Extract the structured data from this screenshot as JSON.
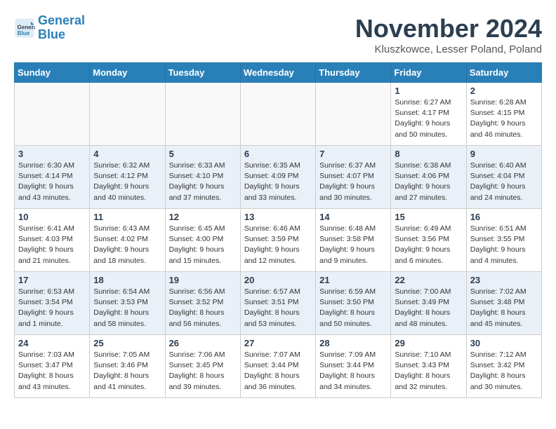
{
  "header": {
    "logo_line1": "General",
    "logo_line2": "Blue",
    "month_title": "November 2024",
    "location": "Kluszkowce, Lesser Poland, Poland"
  },
  "weekdays": [
    "Sunday",
    "Monday",
    "Tuesday",
    "Wednesday",
    "Thursday",
    "Friday",
    "Saturday"
  ],
  "weeks": [
    [
      {
        "day": "",
        "info": ""
      },
      {
        "day": "",
        "info": ""
      },
      {
        "day": "",
        "info": ""
      },
      {
        "day": "",
        "info": ""
      },
      {
        "day": "",
        "info": ""
      },
      {
        "day": "1",
        "info": "Sunrise: 6:27 AM\nSunset: 4:17 PM\nDaylight: 9 hours\nand 50 minutes."
      },
      {
        "day": "2",
        "info": "Sunrise: 6:28 AM\nSunset: 4:15 PM\nDaylight: 9 hours\nand 46 minutes."
      }
    ],
    [
      {
        "day": "3",
        "info": "Sunrise: 6:30 AM\nSunset: 4:14 PM\nDaylight: 9 hours\nand 43 minutes."
      },
      {
        "day": "4",
        "info": "Sunrise: 6:32 AM\nSunset: 4:12 PM\nDaylight: 9 hours\nand 40 minutes."
      },
      {
        "day": "5",
        "info": "Sunrise: 6:33 AM\nSunset: 4:10 PM\nDaylight: 9 hours\nand 37 minutes."
      },
      {
        "day": "6",
        "info": "Sunrise: 6:35 AM\nSunset: 4:09 PM\nDaylight: 9 hours\nand 33 minutes."
      },
      {
        "day": "7",
        "info": "Sunrise: 6:37 AM\nSunset: 4:07 PM\nDaylight: 9 hours\nand 30 minutes."
      },
      {
        "day": "8",
        "info": "Sunrise: 6:38 AM\nSunset: 4:06 PM\nDaylight: 9 hours\nand 27 minutes."
      },
      {
        "day": "9",
        "info": "Sunrise: 6:40 AM\nSunset: 4:04 PM\nDaylight: 9 hours\nand 24 minutes."
      }
    ],
    [
      {
        "day": "10",
        "info": "Sunrise: 6:41 AM\nSunset: 4:03 PM\nDaylight: 9 hours\nand 21 minutes."
      },
      {
        "day": "11",
        "info": "Sunrise: 6:43 AM\nSunset: 4:02 PM\nDaylight: 9 hours\nand 18 minutes."
      },
      {
        "day": "12",
        "info": "Sunrise: 6:45 AM\nSunset: 4:00 PM\nDaylight: 9 hours\nand 15 minutes."
      },
      {
        "day": "13",
        "info": "Sunrise: 6:46 AM\nSunset: 3:59 PM\nDaylight: 9 hours\nand 12 minutes."
      },
      {
        "day": "14",
        "info": "Sunrise: 6:48 AM\nSunset: 3:58 PM\nDaylight: 9 hours\nand 9 minutes."
      },
      {
        "day": "15",
        "info": "Sunrise: 6:49 AM\nSunset: 3:56 PM\nDaylight: 9 hours\nand 6 minutes."
      },
      {
        "day": "16",
        "info": "Sunrise: 6:51 AM\nSunset: 3:55 PM\nDaylight: 9 hours\nand 4 minutes."
      }
    ],
    [
      {
        "day": "17",
        "info": "Sunrise: 6:53 AM\nSunset: 3:54 PM\nDaylight: 9 hours\nand 1 minute."
      },
      {
        "day": "18",
        "info": "Sunrise: 6:54 AM\nSunset: 3:53 PM\nDaylight: 8 hours\nand 58 minutes."
      },
      {
        "day": "19",
        "info": "Sunrise: 6:56 AM\nSunset: 3:52 PM\nDaylight: 8 hours\nand 56 minutes."
      },
      {
        "day": "20",
        "info": "Sunrise: 6:57 AM\nSunset: 3:51 PM\nDaylight: 8 hours\nand 53 minutes."
      },
      {
        "day": "21",
        "info": "Sunrise: 6:59 AM\nSunset: 3:50 PM\nDaylight: 8 hours\nand 50 minutes."
      },
      {
        "day": "22",
        "info": "Sunrise: 7:00 AM\nSunset: 3:49 PM\nDaylight: 8 hours\nand 48 minutes."
      },
      {
        "day": "23",
        "info": "Sunrise: 7:02 AM\nSunset: 3:48 PM\nDaylight: 8 hours\nand 45 minutes."
      }
    ],
    [
      {
        "day": "24",
        "info": "Sunrise: 7:03 AM\nSunset: 3:47 PM\nDaylight: 8 hours\nand 43 minutes."
      },
      {
        "day": "25",
        "info": "Sunrise: 7:05 AM\nSunset: 3:46 PM\nDaylight: 8 hours\nand 41 minutes."
      },
      {
        "day": "26",
        "info": "Sunrise: 7:06 AM\nSunset: 3:45 PM\nDaylight: 8 hours\nand 39 minutes."
      },
      {
        "day": "27",
        "info": "Sunrise: 7:07 AM\nSunset: 3:44 PM\nDaylight: 8 hours\nand 36 minutes."
      },
      {
        "day": "28",
        "info": "Sunrise: 7:09 AM\nSunset: 3:44 PM\nDaylight: 8 hours\nand 34 minutes."
      },
      {
        "day": "29",
        "info": "Sunrise: 7:10 AM\nSunset: 3:43 PM\nDaylight: 8 hours\nand 32 minutes."
      },
      {
        "day": "30",
        "info": "Sunrise: 7:12 AM\nSunset: 3:42 PM\nDaylight: 8 hours\nand 30 minutes."
      }
    ]
  ]
}
